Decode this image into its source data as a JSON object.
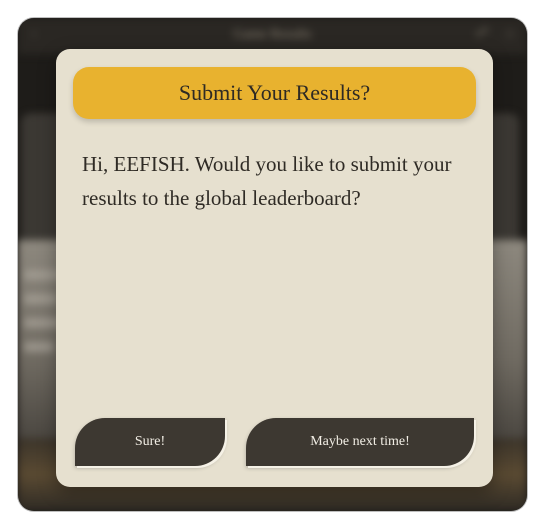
{
  "window": {
    "title": "Game Results"
  },
  "dialog": {
    "title": "Submit Your Results?",
    "message": "Hi, EEFISH. Would you like to submit your results to the global leaderboard?",
    "confirm_label": "Sure!",
    "decline_label": "Maybe next time!"
  },
  "colors": {
    "header_accent": "#e8b22f",
    "dialog_background": "#e6e0cf",
    "button_background": "#3d3831"
  }
}
